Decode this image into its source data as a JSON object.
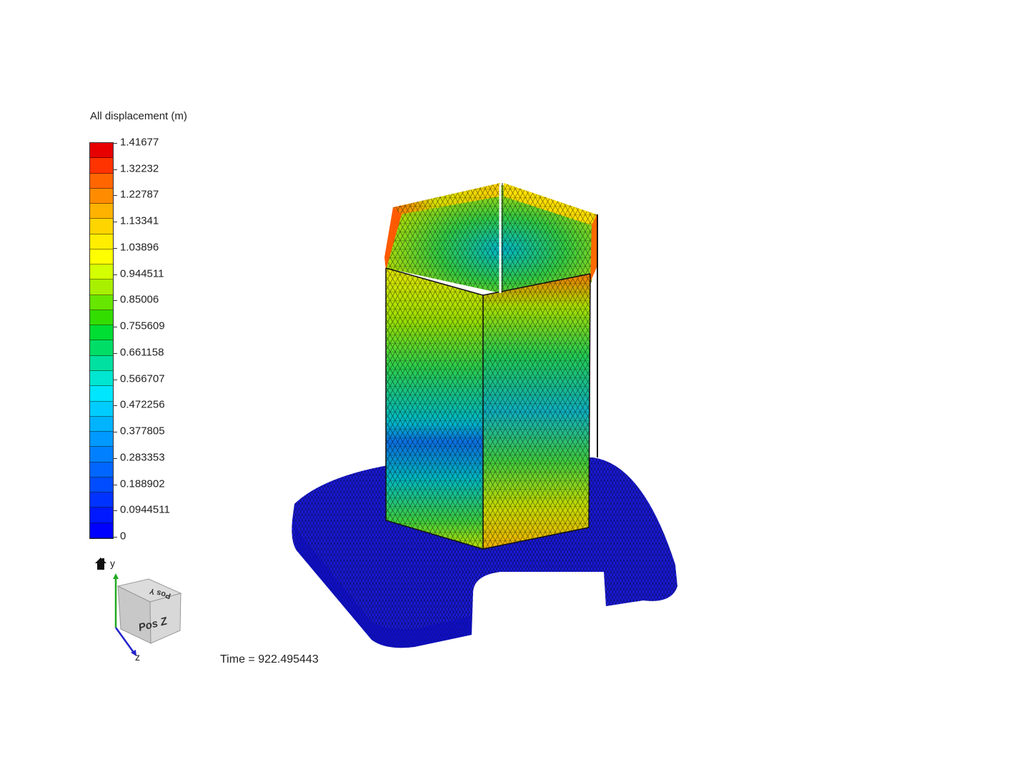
{
  "legend": {
    "title": "All displacement (m)",
    "ticks": [
      "1.41677",
      "1.32232",
      "1.22787",
      "1.13341",
      "1.03896",
      "0.944511",
      "0.85006",
      "0.755609",
      "0.661158",
      "0.566707",
      "0.472256",
      "0.377805",
      "0.283353",
      "0.188902",
      "0.0944511",
      "0"
    ],
    "min": 0,
    "max": 1.41677,
    "band_colors": [
      "#e60000",
      "#ff3300",
      "#ff6600",
      "#ff8c00",
      "#ffb300",
      "#ffd500",
      "#ffee00",
      "#ffff00",
      "#d4ff00",
      "#a8f000",
      "#66e600",
      "#33dd00",
      "#00dd33",
      "#00dd66",
      "#00e0a0",
      "#00e6d0",
      "#00e6ff",
      "#00ccff",
      "#00b3ff",
      "#0099ff",
      "#0080ff",
      "#0066ff",
      "#004dff",
      "#0033ff",
      "#0019ff",
      "#0000ff"
    ]
  },
  "orientation": {
    "home_icon": "home-icon",
    "y_label": "y",
    "z_label": "z",
    "cube_front": "Pos Z",
    "cube_top": "Pos Y",
    "y_axis_color": "#22aa22",
    "z_axis_color": "#2222cc"
  },
  "status": {
    "time_text": "Time = 922.495443"
  },
  "model": {
    "base_color": "#1a1adc",
    "mesh_color": "#000000"
  }
}
